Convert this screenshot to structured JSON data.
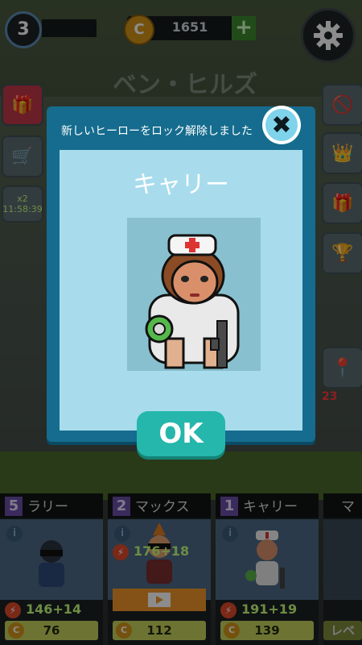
{
  "hud": {
    "level": "3",
    "coins": "1651",
    "coin_symbol": "C",
    "plus": "+"
  },
  "background": {
    "location_title": "ベン・ヒルズ",
    "timer": "11:58:39",
    "multiplier": "x2",
    "badge_count": "23"
  },
  "modal": {
    "title": "新しいヒーローをロック解除しました",
    "hero_name": "キャリー",
    "ok_label": "OK",
    "close_symbol": "✖"
  },
  "cards": [
    {
      "level": "5",
      "name": "ラリー",
      "stat": "146+14",
      "price": "76",
      "coin": "C"
    },
    {
      "level": "2",
      "name": "マックス",
      "stat": "176+18",
      "price": "112",
      "coin": "C"
    },
    {
      "level": "1",
      "name": "キャリー",
      "stat": "191+19",
      "price": "139",
      "coin": "C"
    },
    {
      "level": "",
      "name": "マ",
      "stat": "",
      "price": "レベ",
      "coin": ""
    }
  ],
  "colors": {
    "modal": "#156c8e",
    "panel": "#a8dcec",
    "ok_button": "#25b7ac",
    "close_button": "#7fd3ea"
  }
}
